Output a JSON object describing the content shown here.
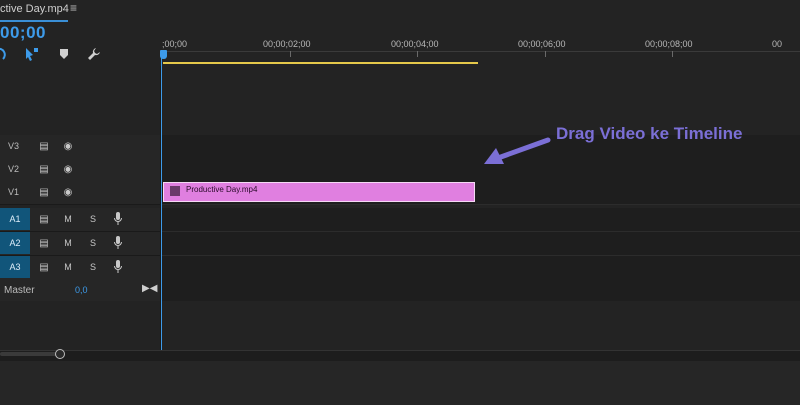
{
  "sequence": {
    "tab_title": "ctive Day.mp4",
    "timecode": "00;00"
  },
  "ruler": {
    "labels": [
      ";00;00",
      "00;00;02;00",
      "00;00;04;00",
      "00;00;06;00",
      "00;00;08;00",
      "00"
    ]
  },
  "tracks": {
    "video": [
      {
        "label": "V3"
      },
      {
        "label": "V2"
      },
      {
        "label": "V1"
      }
    ],
    "audio": [
      {
        "label": "A1",
        "mute": "M",
        "solo": "S"
      },
      {
        "label": "A2",
        "mute": "M",
        "solo": "S"
      },
      {
        "label": "A3",
        "mute": "M",
        "solo": "S"
      }
    ],
    "master": {
      "label": "Master",
      "value": "0,0"
    }
  },
  "clip": {
    "name": "Productive Day.mp4",
    "color": "#e07fe0"
  },
  "annotation": {
    "text": "Drag Video ke Timeline",
    "color": "#7b6fd6"
  },
  "colors": {
    "accent": "#3d9bea",
    "work_area": "#e5c84a"
  }
}
